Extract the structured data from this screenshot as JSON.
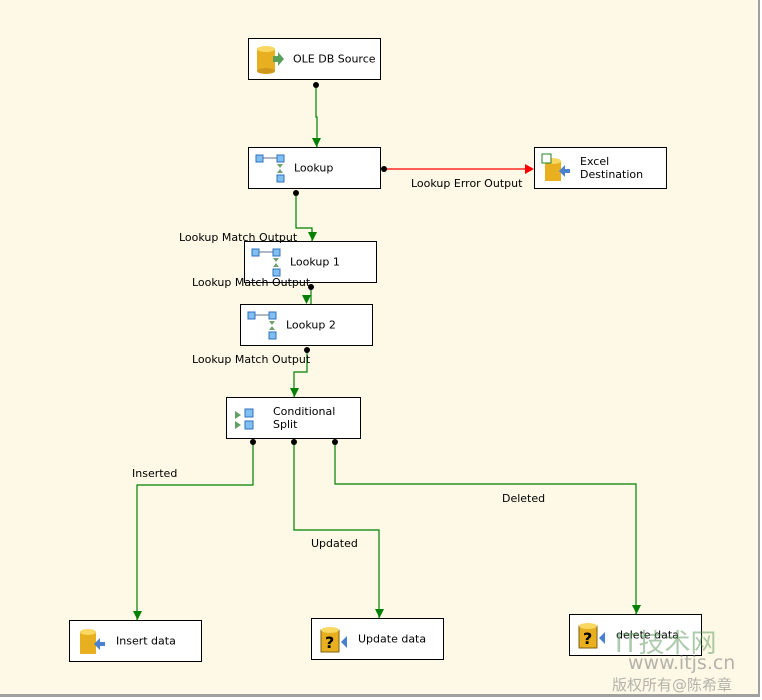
{
  "nodes": {
    "ole_db_source": "OLE DB Source",
    "lookup": "Lookup",
    "excel_destination": "Excel Destination",
    "lookup1": "Lookup 1",
    "lookup2": "Lookup 2",
    "conditional_split": "Conditional Split",
    "insert_data": "Insert data",
    "update_data": "Update data",
    "delete_data": "delete data"
  },
  "paths": {
    "lookup_error": "Lookup Error Output",
    "lookup_match": "Lookup Match Output",
    "lookup1_match": "Lookup Match Output",
    "lookup2_match": "Lookup Match Output",
    "inserted": "Inserted",
    "updated": "Updated",
    "deleted": "Deleted"
  },
  "colors": {
    "success_path": "#008000",
    "error_path": "#ff0000",
    "canvas": "#fdf9e6"
  },
  "watermark": {
    "logo": "IT技术网",
    "url": "www.itjs.cn",
    "copyright": "版权所有@陈希章"
  }
}
